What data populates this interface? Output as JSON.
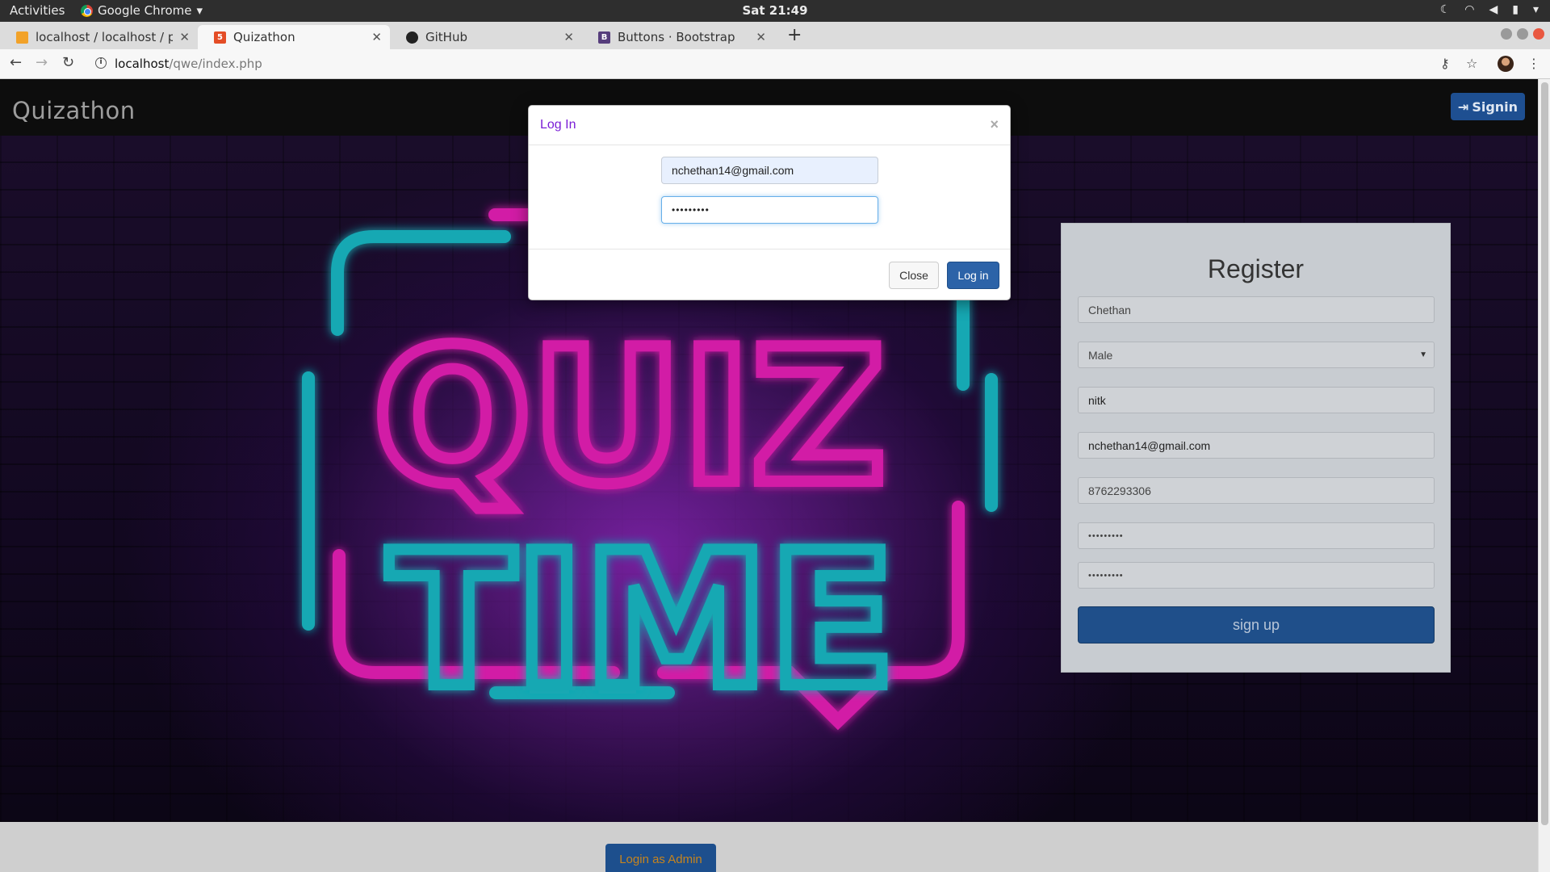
{
  "system_bar": {
    "activities": "Activities",
    "app_name": "Google Chrome",
    "clock": "Sat 21:49",
    "tray_icons": [
      "moon-icon",
      "wifi-icon",
      "volume-icon",
      "battery-icon",
      "chevron-down-icon"
    ]
  },
  "tabs": [
    {
      "title": "localhost / localhost / pro",
      "favicon": "phpmyadmin-icon",
      "active": false
    },
    {
      "title": "Quizathon",
      "favicon": "html5-icon",
      "active": true
    },
    {
      "title": "GitHub",
      "favicon": "github-icon",
      "active": false
    },
    {
      "title": "Buttons · Bootstrap",
      "favicon": "bootstrap-icon",
      "favicon_text": "B",
      "active": false
    }
  ],
  "addressbar": {
    "host": "localhost",
    "path": "/qwe/index.php"
  },
  "navbar": {
    "brand": "Quizathon",
    "signin_label": "Signin"
  },
  "hero": {
    "line1": "QUIZ",
    "line2": "TIME",
    "colors": {
      "pink": "#d21aa6",
      "teal": "#17a8b3"
    }
  },
  "register": {
    "title": "Register",
    "fields": {
      "name": "Chethan",
      "gender": "Male",
      "college": "nitk",
      "email": "nchethan14@gmail.com",
      "phone": "8762293306",
      "password": "•••••••••",
      "confirm_password": "•••••••••"
    },
    "submit_label": "sign up"
  },
  "admin_button": "Login as Admin",
  "modal": {
    "title": "Log In",
    "close_symbol": "×",
    "email_value": "nchethan14@gmail.com",
    "password_value": "•••••••••",
    "close_label": "Close",
    "login_label": "Log in"
  },
  "colors": {
    "navbar_bg": "#0d0d0d",
    "primary_button": "#1f4f8a",
    "modal_title": "#7a1ed6"
  }
}
